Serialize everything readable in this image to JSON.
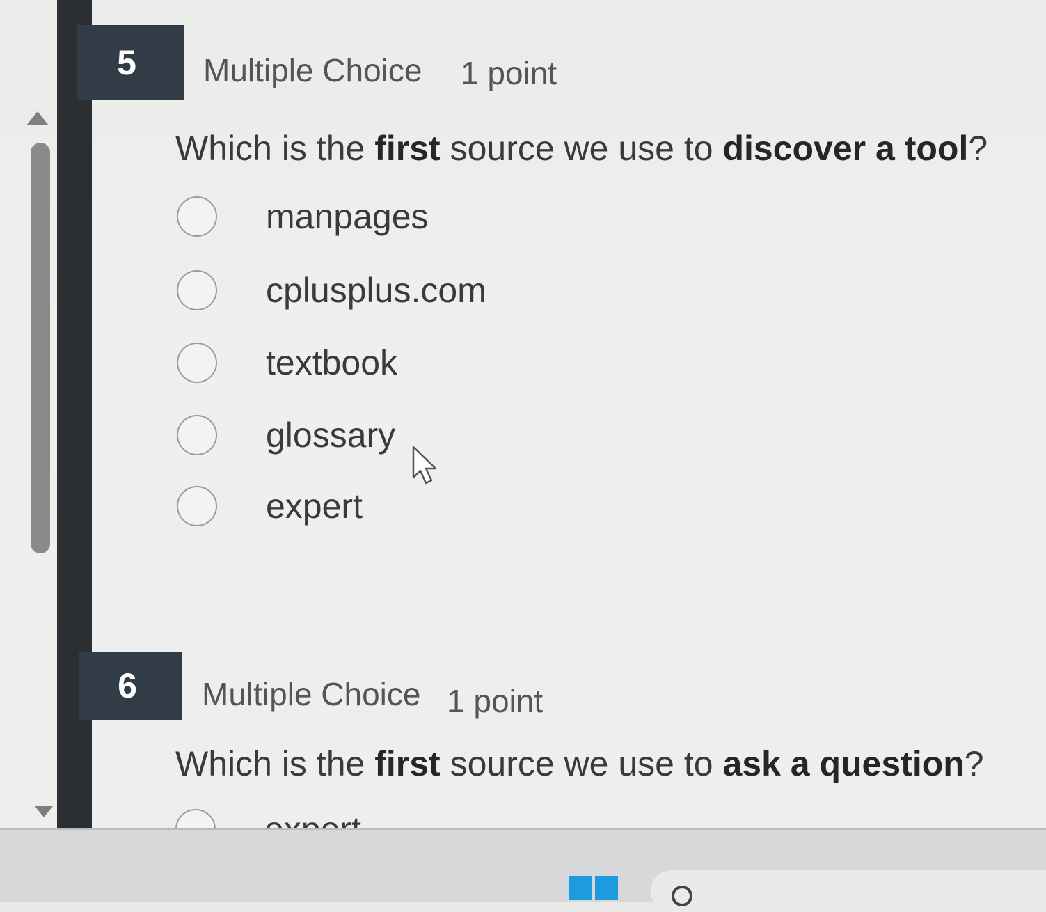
{
  "questions": [
    {
      "number": "5",
      "type": "Multiple Choice",
      "points": "1 point",
      "prompt": {
        "p1": "Which is the ",
        "b1": "first",
        "p2": " source we use to ",
        "b2": "discover a tool",
        "p3": "?"
      },
      "options": [
        "manpages",
        "cplusplus.com",
        "textbook",
        "glossary",
        "expert"
      ]
    },
    {
      "number": "6",
      "type": "Multiple Choice",
      "points": "1 point",
      "prompt": {
        "p1": "Which is the ",
        "b1": "first",
        "p2": " source we use to ",
        "b2": "ask a question",
        "p3": "?"
      },
      "options": [
        "expert"
      ]
    }
  ],
  "icons": {
    "scroll_up": "triangle-up-icon",
    "scroll_down": "triangle-down-icon",
    "cursor": "mouse-pointer-icon",
    "start": "windows-logo-icon",
    "search": "search-icon"
  },
  "colors": {
    "tab_bg": "#313c47",
    "rail": "#2b2f33",
    "windows_blue": "#1e9be0"
  }
}
